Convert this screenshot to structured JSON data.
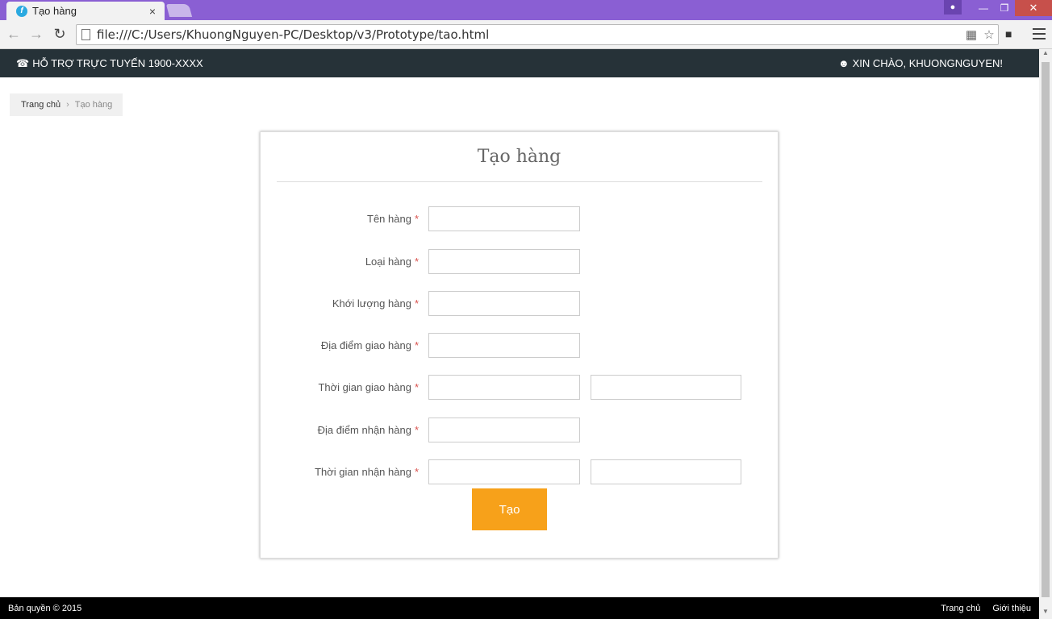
{
  "browser": {
    "tab_title": "Tạo hàng",
    "tab_close": "×",
    "url": "file:///C:/Users/KhuongNguyen-PC/Desktop/v3/Prototype/tao.html"
  },
  "topbar": {
    "support_text": "HỖ TRỢ TRỰC TUYẾN 1900-XXXX",
    "greeting": "XIN CHÀO, KHUONGNGUYEN!"
  },
  "breadcrumb": {
    "home": "Trang chủ",
    "separator": "›",
    "current": "Tạo hàng"
  },
  "form": {
    "title": "Tạo hàng",
    "required_mark": "*",
    "fields": [
      {
        "label": "Tên hàng",
        "value": "",
        "value2": ""
      },
      {
        "label": "Loại hàng",
        "value": ""
      },
      {
        "label": "Khới lượng hàng",
        "value": ""
      },
      {
        "label": "Địa điểm giao hàng",
        "value": ""
      },
      {
        "label": "Thời gian giao hàng",
        "value": "",
        "value2": ""
      },
      {
        "label": "Địa điểm nhận hàng",
        "value": ""
      },
      {
        "label": "Thời gian nhận hàng",
        "value": "",
        "value2": ""
      }
    ],
    "submit_label": "Tạo"
  },
  "footer": {
    "copyright": "Bản quyền © 2015",
    "links": [
      "Trang chủ",
      "Giới thiệu"
    ]
  },
  "colors": {
    "titlebar": "#8a5fd3",
    "topbar": "#263238",
    "accent_button": "#f7a11a",
    "required": "#d9534f"
  }
}
